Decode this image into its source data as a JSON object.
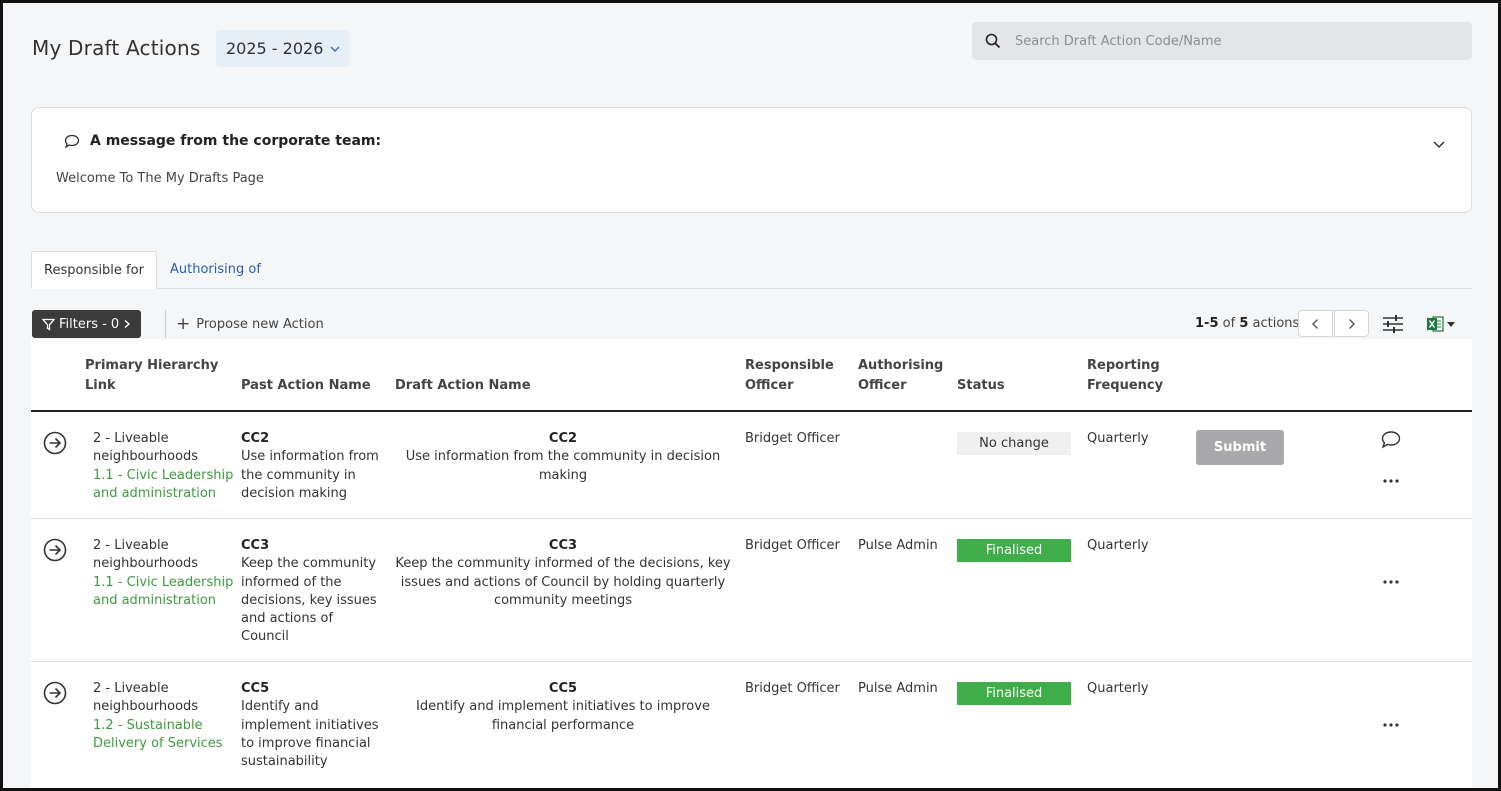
{
  "header": {
    "title": "My Draft Actions",
    "year": "2025 - 2026",
    "search_placeholder": "Search Draft Action Code/Name"
  },
  "message": {
    "heading": "A message from the corporate team:",
    "body": "Welcome To The My Drafts Page"
  },
  "tabs": [
    {
      "label": "Responsible for",
      "active": true
    },
    {
      "label": "Authorising of",
      "active": false
    }
  ],
  "toolbar": {
    "filters_label": "Filters - 0",
    "propose_label": "Propose new Action",
    "range": "1-5",
    "of": "of",
    "total": "5",
    "unit": "actions"
  },
  "columns": {
    "hierarchy": [
      "Primary Hierarchy",
      "Link"
    ],
    "past": "Past Action Name",
    "draft": "Draft Action Name",
    "responsible": [
      "Responsible",
      "Officer"
    ],
    "authorising": [
      "Authorising",
      "Officer"
    ],
    "status": "Status",
    "frequency": [
      "Reporting",
      "Frequency"
    ]
  },
  "rows": [
    {
      "hierarchy": [
        "2 - Liveable",
        "neighbourhoods"
      ],
      "hierarchy_link": [
        "1.1 - Civic Leadership",
        "and administration"
      ],
      "past_code": "CC2",
      "past_name": [
        "Use information from",
        "the community in",
        "decision making"
      ],
      "draft_code": "CC2",
      "draft_name": [
        "Use information from the community in decision",
        "making"
      ],
      "responsible": "Bridget Officer",
      "authorising": "",
      "status": "No change",
      "frequency": "Quarterly",
      "submit_label": "Submit"
    },
    {
      "hierarchy": [
        "2 - Liveable",
        "neighbourhoods"
      ],
      "hierarchy_link": [
        "1.1 - Civic Leadership",
        "and administration"
      ],
      "past_code": "CC3",
      "past_name": [
        "Keep the community",
        "informed of the",
        "decisions, key issues",
        "and actions of",
        "Council"
      ],
      "draft_code": "CC3",
      "draft_name": [
        "Keep the community informed of the decisions, key",
        "issues and actions of Council by holding quarterly",
        "community meetings"
      ],
      "responsible": "Bridget Officer",
      "authorising": "Pulse Admin",
      "status": "Finalised",
      "frequency": "Quarterly"
    },
    {
      "hierarchy": [
        "2 - Liveable",
        "neighbourhoods"
      ],
      "hierarchy_link": [
        "1.2 - Sustainable",
        "Delivery of Services"
      ],
      "past_code": "CC5",
      "past_name": [
        "Identify and",
        "implement initiatives",
        "to improve financial",
        "sustainability"
      ],
      "draft_code": "CC5",
      "draft_name": [
        "Identify and implement initiatives to improve",
        "financial performance"
      ],
      "responsible": "Bridget Officer",
      "authorising": "Pulse Admin",
      "status": "Finalised",
      "frequency": "Quarterly"
    }
  ],
  "colors": {
    "finalised": "#3fae4a",
    "link_green": "#3d9a3d",
    "tab_link": "#2a5db0"
  },
  "icons": {
    "search": "search-icon",
    "chevron": "chevron-down-icon",
    "comment": "comment-icon",
    "filter": "filter-icon",
    "goto": "arrow-circle-right-icon",
    "more": "more-horizontal-icon",
    "columns": "sliders-icon",
    "excel": "excel-icon"
  }
}
